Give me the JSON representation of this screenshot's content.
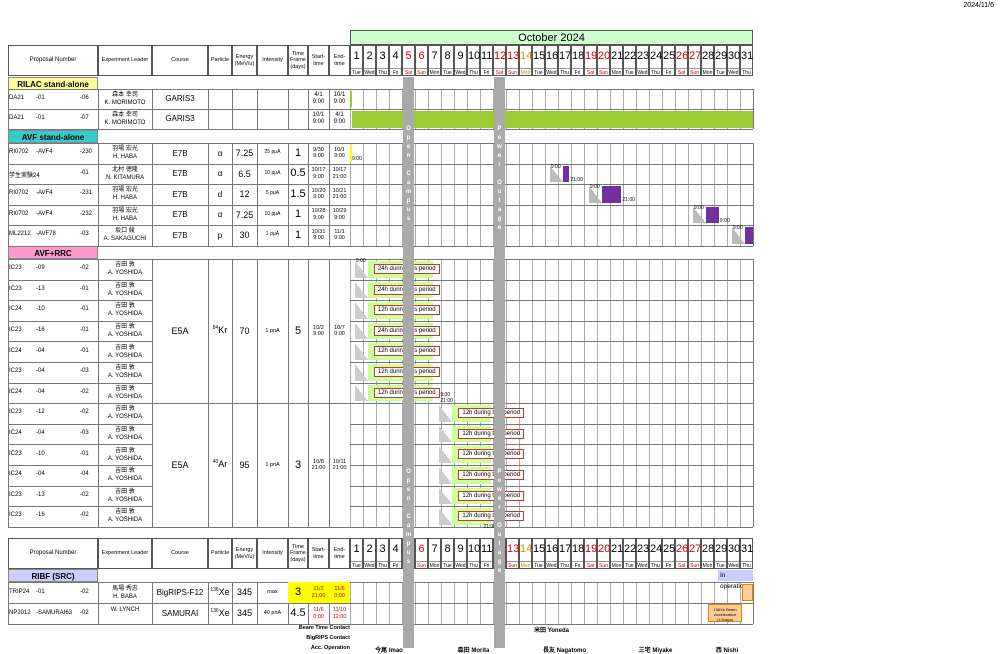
{
  "header_date": "2024/11/6",
  "month_title": "October 2024",
  "columns": {
    "proposal": "Proposal Number",
    "leader": "Experiment Leader",
    "course": "Course",
    "particle": "Particle",
    "energy": "Energy (MeV/u)",
    "intensity": "Intensity",
    "timeframe": "Time Frame (days)",
    "start": "Start- time",
    "end": "End- time"
  },
  "days": [
    {
      "n": "1",
      "w": "Tue",
      "c": ""
    },
    {
      "n": "2",
      "w": "Wed",
      "c": ""
    },
    {
      "n": "3",
      "w": "Thu",
      "c": ""
    },
    {
      "n": "4",
      "w": "Fri",
      "c": ""
    },
    {
      "n": "5",
      "w": "Sat",
      "c": "red"
    },
    {
      "n": "6",
      "w": "Sun",
      "c": "red"
    },
    {
      "n": "7",
      "w": "Mon",
      "c": ""
    },
    {
      "n": "8",
      "w": "Tue",
      "c": ""
    },
    {
      "n": "9",
      "w": "Wed",
      "c": ""
    },
    {
      "n": "10",
      "w": "Thu",
      "c": ""
    },
    {
      "n": "11",
      "w": "Fri",
      "c": ""
    },
    {
      "n": "12",
      "w": "Sat",
      "c": "red"
    },
    {
      "n": "13",
      "w": "Sun",
      "c": "red"
    },
    {
      "n": "14",
      "w": "Mon",
      "c": "orange"
    },
    {
      "n": "15",
      "w": "Tue",
      "c": ""
    },
    {
      "n": "16",
      "w": "Wed",
      "c": ""
    },
    {
      "n": "17",
      "w": "Thu",
      "c": ""
    },
    {
      "n": "18",
      "w": "Fri",
      "c": ""
    },
    {
      "n": "19",
      "w": "Sat",
      "c": "red"
    },
    {
      "n": "20",
      "w": "Sun",
      "c": "red"
    },
    {
      "n": "21",
      "w": "Mon",
      "c": ""
    },
    {
      "n": "22",
      "w": "Tue",
      "c": ""
    },
    {
      "n": "23",
      "w": "Wed",
      "c": ""
    },
    {
      "n": "24",
      "w": "Thu",
      "c": ""
    },
    {
      "n": "25",
      "w": "Fri",
      "c": ""
    },
    {
      "n": "26",
      "w": "Sat",
      "c": "red"
    },
    {
      "n": "27",
      "w": "Sun",
      "c": "red"
    },
    {
      "n": "28",
      "w": "Mon",
      "c": ""
    },
    {
      "n": "29",
      "w": "Tue",
      "c": ""
    },
    {
      "n": "30",
      "w": "Wed",
      "c": ""
    },
    {
      "n": "31",
      "w": "Thu",
      "c": ""
    }
  ],
  "sections": {
    "rilac": "RILAC stand-alone",
    "avf": "AVF stand-alone",
    "avfrrc": "AVF+RRC",
    "ribf": "RIBF (SRC)"
  },
  "rilac_rows": [
    {
      "prop": "DA21",
      "mid": "-01",
      "sfx": "-06",
      "leader_jp": "森本 幸司",
      "leader": "K. MORIMOTO",
      "course": "GARIS3",
      "start": "4/1\n9:00",
      "end": "10/1\n9:00"
    },
    {
      "prop": "DA21",
      "mid": "-01",
      "sfx": "-07",
      "leader_jp": "森本 幸司",
      "leader": "K. MORIMOTO",
      "course": "GARIS3",
      "start": "10/1\n9:00",
      "end": "4/1\n9:00"
    }
  ],
  "avf_rows": [
    {
      "prop": "RI0702",
      "mid": "-AVF4",
      "sfx": "-230",
      "leader_jp": "羽場 宏光",
      "leader": "H. HABA",
      "course": "E7B",
      "particle": "α",
      "energy": "7.25",
      "intensity": "25 pμA",
      "tf": "1",
      "start": "9/30\n9:00",
      "end": "10/1\n9:00"
    },
    {
      "prop": "学生実験24",
      "mid": "",
      "sfx": "-01",
      "leader_jp": "北村 徳隆",
      "leader": "N. KITAMURA",
      "course": "E7B",
      "particle": "α",
      "energy": "6.5",
      "intensity": "10 pμA",
      "tf": "0.5",
      "start": "10/17\n9:00",
      "end": "10/17\n21:00"
    },
    {
      "prop": "RI0702",
      "mid": "-AVF4",
      "sfx": "-231",
      "leader_jp": "羽場 宏光",
      "leader": "H. HABA",
      "course": "E7B",
      "particle": "d",
      "energy": "12",
      "intensity": "5 pμA",
      "tf": "1.5",
      "start": "10/20\n9:00",
      "end": "10/21\n21:00"
    },
    {
      "prop": "RI0702",
      "mid": "-AVF4",
      "sfx": "-232",
      "leader_jp": "羽場 宏光",
      "leader": "H. HABA",
      "course": "E7B",
      "particle": "α",
      "energy": "7.25",
      "intensity": "10 pμA",
      "tf": "1",
      "start": "10/28\n9:00",
      "end": "10/29\n9:00"
    },
    {
      "prop": "ML2212",
      "mid": "-AVF78",
      "sfx": "-03",
      "leader_jp": "坂口 綾",
      "leader": "A. SAKAGUCHI",
      "course": "E7B",
      "particle": "p",
      "energy": "30",
      "intensity": "1 pμA",
      "tf": "1",
      "start": "10/31\n9:00",
      "end": "11/1\n9:00"
    }
  ],
  "avf_times": [
    "9:00",
    "9:00",
    "21:00",
    "9:00",
    "21:00",
    "9:00",
    "9:00",
    "9:00"
  ],
  "rrc_rows": [
    {
      "prop": "IC23",
      "mid": "-09",
      "sfx": "-02",
      "tag": "24h during this period"
    },
    {
      "prop": "IC23",
      "mid": "-13",
      "sfx": "-01",
      "tag": "24h during this period"
    },
    {
      "prop": "IC24",
      "mid": "-10",
      "sfx": "-01",
      "tag": "12h during this period"
    },
    {
      "prop": "IC23",
      "mid": "-16",
      "sfx": "-01",
      "tag": "24h during this period"
    },
    {
      "prop": "IC24",
      "mid": "-04",
      "sfx": "-01",
      "tag": "12h during this period"
    },
    {
      "prop": "IC23",
      "mid": "-04",
      "sfx": "-03",
      "tag": "12h during this period"
    },
    {
      "prop": "IC24",
      "mid": "-04",
      "sfx": "-02",
      "tag": "12h during this period"
    },
    {
      "prop": "IC23",
      "mid": "-12",
      "sfx": "-02",
      "tag": "12h during this period"
    },
    {
      "prop": "IC24",
      "mid": "-04",
      "sfx": "-03",
      "tag": "12h during this period"
    },
    {
      "prop": "IC23",
      "mid": "-10",
      "sfx": "-01",
      "tag": "12h during this period"
    },
    {
      "prop": "IC24",
      "mid": "-04",
      "sfx": "-04",
      "tag": "12h during this period"
    },
    {
      "prop": "IC23",
      "mid": "-13",
      "sfx": "-02",
      "tag": "12h during this period"
    },
    {
      "prop": "IC23",
      "mid": "-16",
      "sfx": "-02",
      "tag": "12h during this period"
    }
  ],
  "rrc_leader_jp": "吉田 敦",
  "rrc_leader": "A. YOSHIDA",
  "rrc_group1": {
    "course": "E5A",
    "mass": "84",
    "elem": "Kr",
    "energy": "70",
    "intensity": "1 pnA",
    "tf": "5",
    "start": "10/2\n9:00",
    "end": "10/7\n9:00"
  },
  "rrc_group2": {
    "course": "E5A",
    "mass": "40",
    "elem": "Ar",
    "energy": "95",
    "intensity": "1 pnA",
    "tf": "3",
    "start": "10/8\n21:00",
    "end": "10/11\n21:00"
  },
  "rrc_times": [
    "9:00",
    "9:00",
    "21:00",
    "21:00"
  ],
  "open_campus": "Open Campus",
  "power_outage": "Power Outage",
  "in_operation": "In operation",
  "ribf_rows": [
    {
      "prop": "TRIP24",
      "mid": "-01",
      "sfx": "-02",
      "leader_jp": "馬場 秀忠",
      "leader": "H. BABA",
      "course": "BigRIPS-F12",
      "mass": "136",
      "elem": "Xe",
      "energy": "345",
      "intensity": "max",
      "tf": "3",
      "start": "11/2\n21:00",
      "end": "11/6\n0:00"
    },
    {
      "prop": "NP2012",
      "mid": "-SAMURAI63",
      "sfx": "-02",
      "leader_jp": "",
      "leader": "W. LYNCH",
      "course": "SAMURAI",
      "mass": "136",
      "elem": "Xe",
      "energy": "345",
      "intensity": "40 pnA",
      "tf": "4.5",
      "start": "11/6\n0:00",
      "end": "11/10\n12:00"
    }
  ],
  "accel_note": "136Xe Beam Acceleration (1.5days)",
  "contacts": {
    "beam_label": "Beam Time Contact",
    "beam_value": "米田 Yoneda",
    "bigrips_label": "BigRIPS Contact",
    "acc_label": "Acc. Operation",
    "acc_values": [
      "今尾 Imao",
      "森田 Morita",
      "長友 Nagatomo",
      "三宅 Miyake",
      "西 Nishi"
    ]
  },
  "colors": {
    "month_bg": "#ccffcc",
    "rilac": "#ffff99",
    "avf": "#33cccc",
    "avfrrc": "#ff99cc",
    "ribf": "#ccccff",
    "beam": "#99cc33",
    "light": "#ccff99",
    "purple": "#7030a0"
  }
}
